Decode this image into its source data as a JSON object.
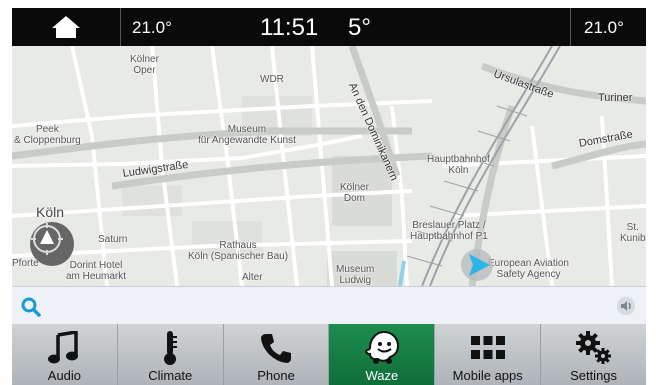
{
  "topbar": {
    "left_temp": "21.0°",
    "time": "11:51",
    "outside_temp": "5°",
    "right_temp": "21.0°"
  },
  "map": {
    "labels": {
      "koelner_oper": "Kölner\nOper",
      "wdr": "WDR",
      "an_den_dominikanern": "An den Dominikanern",
      "ursulastrasse": "Ursulastraße",
      "turiner": "Turiner",
      "peek": "Peek\n& Cloppenburg",
      "museum_angewandte": "Museum\nfür Angewandte Kunst",
      "domstrasse": "Domstraße",
      "hauptbahnhof": "Hauptbahnhof\nKöln",
      "ludwigstrasse": "Ludwigstraße",
      "koelner_dom": "Kölner\nDom",
      "koeln": "Köln",
      "breslauer_platz": "Breslauer Platz /\nHauptbahnhof P1",
      "st_kunibert": "St.\nKunib",
      "saturn": "Saturn",
      "rathaus": "Rathaus\nKöln (Spanischer Bau)",
      "european_aviation": "European Aviation\nSafety Agency",
      "dorint": "Dorint Hotel\nam Heumarkt",
      "alter": "Alter",
      "museum_ludwig": "Museum\nLudwig",
      "pfoerte": "Pforte"
    }
  },
  "search": {
    "placeholder": ""
  },
  "nav": {
    "items": [
      {
        "label": "Audio"
      },
      {
        "label": "Climate"
      },
      {
        "label": "Phone"
      },
      {
        "label": "Waze"
      },
      {
        "label": "Mobile apps"
      },
      {
        "label": "Settings"
      }
    ]
  },
  "colors": {
    "active_tab": "#1e8d4e",
    "nav_marker": "#29b6e8"
  }
}
